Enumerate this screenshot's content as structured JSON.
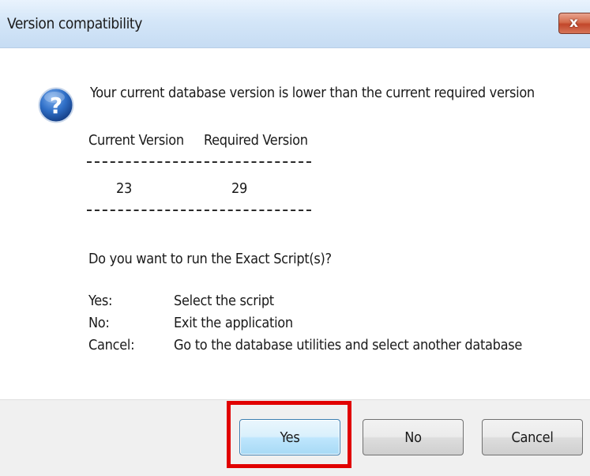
{
  "window": {
    "title": "Version compatibility",
    "close_symbol": "x"
  },
  "icons": {
    "question": "question-icon",
    "close": "close-icon"
  },
  "message": {
    "headline": "Your current database version is lower than the current required version",
    "current_version_header": "Current Version",
    "required_version_header": "Required Version",
    "current_version_value": "23",
    "required_version_value": "29",
    "prompt": "Do you want to run the Exact Script(s)?",
    "options": [
      {
        "key": "Yes:",
        "description": "Select the script"
      },
      {
        "key": "No:",
        "description": "Exit the application"
      },
      {
        "key": "Cancel:",
        "description": "Go to the database utilities and select another database"
      }
    ]
  },
  "buttons": {
    "yes_label": "Yes",
    "no_label": "No",
    "cancel_label": "Cancel"
  },
  "colors": {
    "highlight": "#e10000",
    "icon_blue": "#1f5fb8",
    "close_red": "#c2472b"
  }
}
